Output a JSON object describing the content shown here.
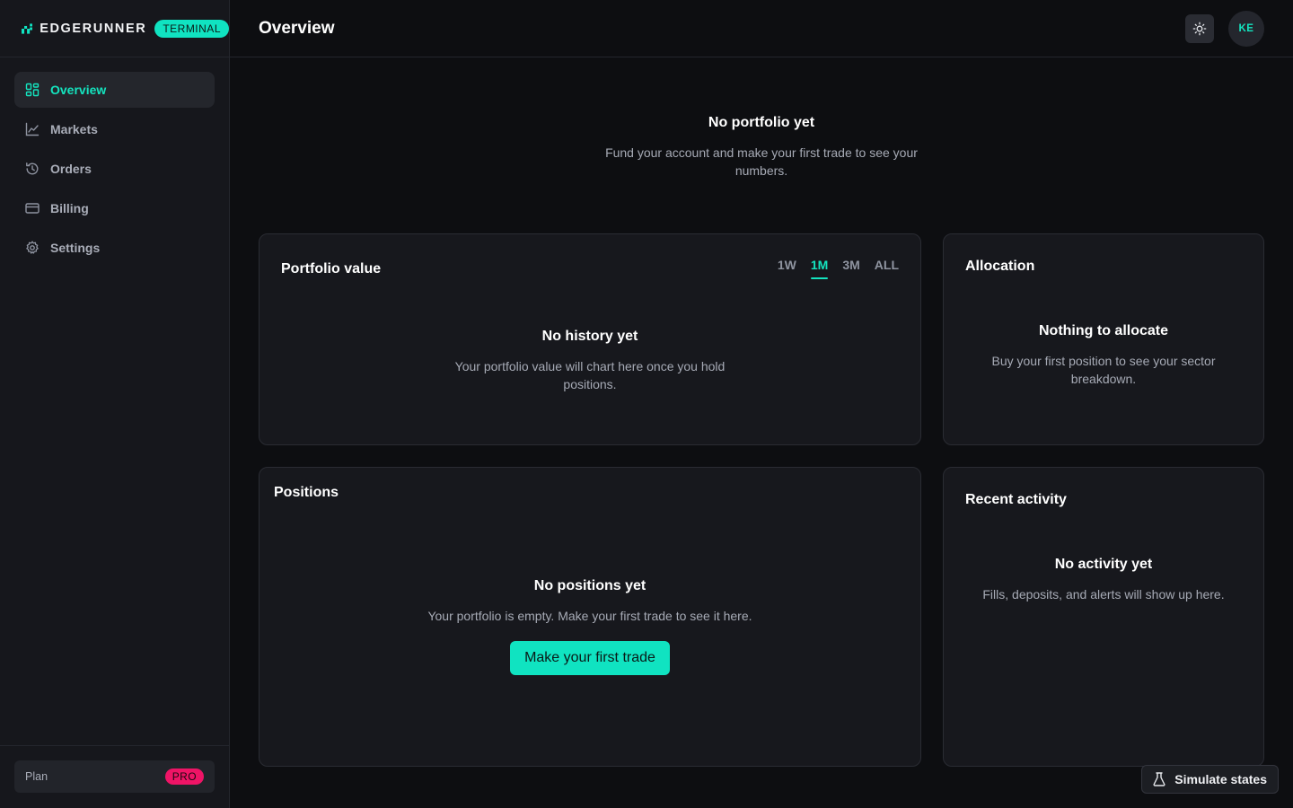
{
  "brand": {
    "name": "EDGERUNNER",
    "tag": "TERMINAL"
  },
  "sidebar": {
    "items": [
      {
        "label": "Overview",
        "icon": "grid-icon",
        "active": true
      },
      {
        "label": "Markets",
        "icon": "chart-line-icon"
      },
      {
        "label": "Orders",
        "icon": "history-icon"
      },
      {
        "label": "Billing",
        "icon": "credit-card-icon"
      },
      {
        "label": "Settings",
        "icon": "gear-icon"
      }
    ],
    "plan": {
      "label": "Plan",
      "badge": "PRO"
    }
  },
  "header": {
    "title": "Overview",
    "avatar_initials": "KE",
    "theme_icon": "sun-icon"
  },
  "hero": {
    "title": "No portfolio yet",
    "text": "Fund your account and make your first trade to see your numbers."
  },
  "portfolio": {
    "title": "Portfolio value",
    "tabs": [
      "1W",
      "1M",
      "3M",
      "ALL"
    ],
    "active_tab": "1M",
    "empty_title": "No history yet",
    "empty_text": "Your portfolio value will chart here once you hold positions."
  },
  "allocation": {
    "title": "Allocation",
    "empty_title": "Nothing to allocate",
    "empty_text": "Buy your first position to see your sector breakdown."
  },
  "positions": {
    "title": "Positions",
    "empty_title": "No positions yet",
    "empty_text": "Your portfolio is empty. Make your first trade to see it here.",
    "cta": "Make your first trade"
  },
  "activity": {
    "title": "Recent activity",
    "empty_title": "No activity yet",
    "empty_text": "Fills, deposits, and alerts will show up here."
  },
  "simulate": {
    "label": "Simulate states",
    "icon": "flask-icon"
  },
  "colors": {
    "accent": "#14e4bf",
    "pro_badge": "#ef1466",
    "background": "#0d0e11"
  }
}
